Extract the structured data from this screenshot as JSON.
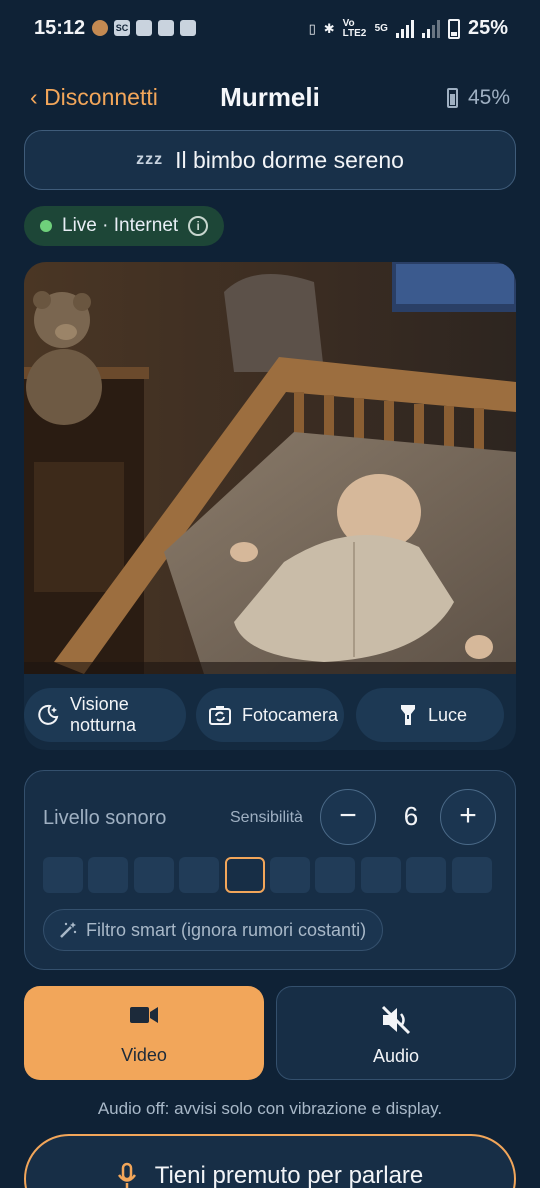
{
  "status_bar": {
    "time": "15:12",
    "battery_percent": "25%",
    "app_icons": [
      "bear-icon",
      "sc-icon",
      "wallet-icon",
      "clipboard-icon",
      "game-icon"
    ],
    "sc_label": "SC",
    "network_label": "Vo LTE2",
    "network_type": "5G"
  },
  "header": {
    "back_label": "Disconnetti",
    "title": "Murmeli",
    "device_battery": "45%"
  },
  "sleep_status": {
    "icon": "zzz-icon",
    "zzz": "zzz",
    "text": "Il bimbo dorme sereno"
  },
  "connection": {
    "label": "Live · Internet",
    "status_color": "#6fd07b",
    "info_glyph": "i"
  },
  "camera_actions": [
    {
      "label": "Visione notturna",
      "icon": "night-vision-icon"
    },
    {
      "label": "Fotocamera",
      "icon": "camera-switch-icon"
    },
    {
      "label": "Luce",
      "icon": "flashlight-icon"
    }
  ],
  "sound": {
    "title": "Livello sonoro",
    "sensitivity_label": "Sensibilità",
    "minus": "−",
    "plus": "+",
    "sensitivity_value": "6",
    "level_segments": 10,
    "active_segment": 5,
    "smart_filter": "Filtro smart (ignora rumori costanti)"
  },
  "modes": {
    "video_label": "Video",
    "audio_label": "Audio",
    "selected": "video"
  },
  "note": "Audio off: avvisi solo con vibrazione e display.",
  "push_to_talk": {
    "label": "Tieni premuto per parlare",
    "icon": "microphone-icon"
  },
  "colors": {
    "accent": "#f2a65a",
    "background": "#0f2236",
    "live_green": "#6fd07b"
  }
}
